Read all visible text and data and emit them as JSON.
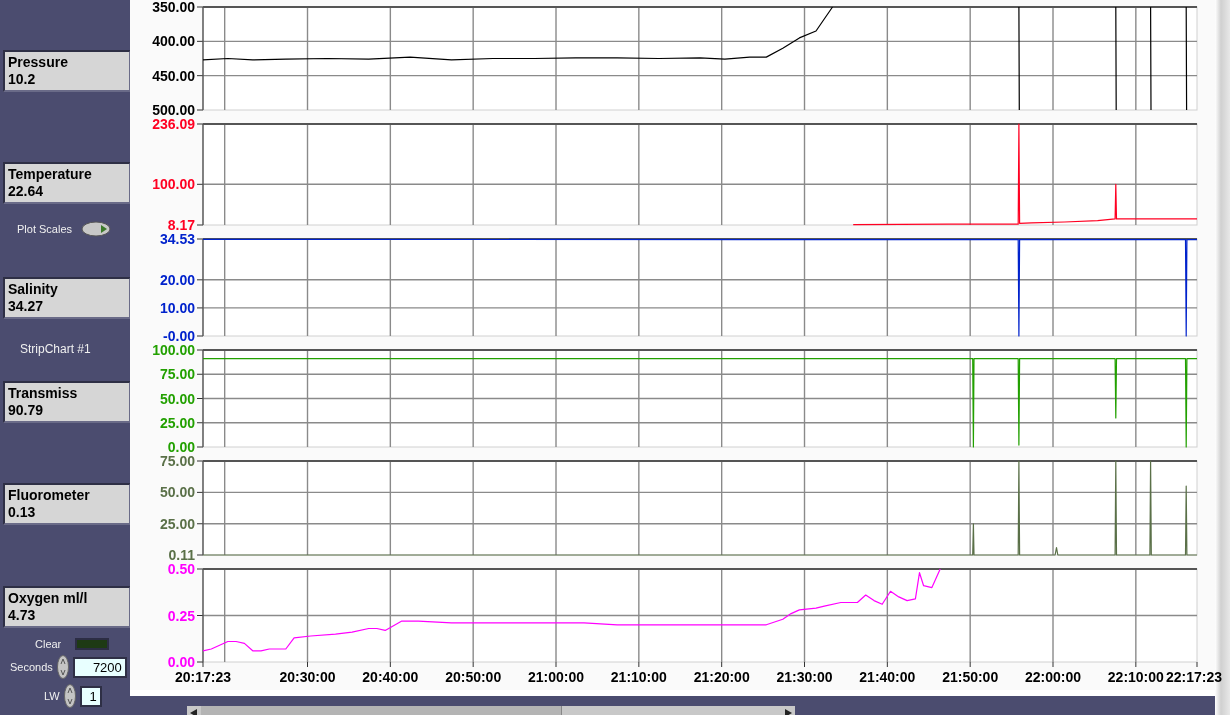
{
  "sidebar": {
    "items": [
      {
        "kind": "indicator",
        "label": "Pressure",
        "value": "10.2"
      },
      {
        "kind": "indicator",
        "label": "Temperature",
        "value": "22.64"
      },
      {
        "kind": "toggle",
        "label": "Plot Scales"
      },
      {
        "kind": "indicator",
        "label": "Salinity",
        "value": "34.27"
      },
      {
        "kind": "caption",
        "label": "StripChart #1"
      },
      {
        "kind": "indicator",
        "label": "Transmiss",
        "value": "90.79"
      },
      {
        "kind": "indicator",
        "label": "Fluorometer",
        "value": "0.13"
      },
      {
        "kind": "indicator",
        "label": "Oxygen ml/l",
        "value": "4.73"
      },
      {
        "kind": "led",
        "label": "Clear",
        "on": false
      },
      {
        "kind": "spinner",
        "label": "Seconds",
        "value": "7200"
      },
      {
        "kind": "spinner",
        "label": "LW",
        "value": "1"
      }
    ]
  },
  "charts": [
    {
      "chart_data": {
        "type": "line",
        "grid": true,
        "xlim": [
          73043,
          80243
        ],
        "ylim": [
          500,
          350
        ],
        "yticks": [
          {
            "value": 350,
            "label": "350.00"
          },
          {
            "value": 400,
            "label": "400.00"
          },
          {
            "value": 450,
            "label": "450.00"
          },
          {
            "value": 500,
            "label": "500.00"
          }
        ],
        "x": [
          73043,
          73223,
          73403,
          73643,
          73943,
          74243,
          74543,
          74843,
          75143,
          75443,
          75743,
          76043,
          76343,
          76643,
          76823,
          77003,
          77123,
          77243,
          77363,
          77483,
          77603,
          78950,
          78953,
          78956,
          79652,
          79655,
          79658,
          79904,
          79907,
          79910,
          80162,
          80165,
          80168
        ],
        "series": [
          {
            "color": "#000000",
            "values": [
              427,
              425,
              427,
              426,
              425,
              426,
              423,
              427,
              425,
              425,
              424,
              424,
              425,
              424,
              426,
              423,
              423,
              410,
              395,
              385,
              350,
              null,
              350,
              500,
              null,
              350,
              500,
              null,
              350,
              500,
              null,
              350,
              500
            ]
          }
        ]
      }
    },
    {
      "chart_data": {
        "type": "line",
        "grid": true,
        "xlim": [
          73043,
          80243
        ],
        "ylim": [
          8.17,
          236.09
        ],
        "yticks": [
          {
            "value": 236.09,
            "label": "236.09"
          },
          {
            "value": 100,
            "label": "100.00"
          },
          {
            "value": 8.17,
            "label": "8.17"
          }
        ],
        "x": [
          77753,
          78443,
          78948,
          78953,
          78958,
          79043,
          79283,
          79523,
          79650,
          79655,
          79660,
          80243
        ],
        "series": [
          {
            "color": "#ff0022",
            "values": [
              9,
              10,
              10,
              236,
              12,
              13,
              15,
              18,
              22,
              100,
              22,
              22
            ]
          }
        ]
      }
    },
    {
      "chart_data": {
        "type": "line",
        "grid": true,
        "xlim": [
          73043,
          80243
        ],
        "ylim": [
          0,
          34.53
        ],
        "yticks": [
          {
            "value": 34.53,
            "label": "34.53"
          },
          {
            "value": 20,
            "label": "20.00"
          },
          {
            "value": 10,
            "label": "10.00"
          },
          {
            "value": 0,
            "label": "-0.00"
          }
        ],
        "x": [
          73043,
          78948,
          78953,
          78958,
          80160,
          80165,
          80170,
          80243
        ],
        "series": [
          {
            "color": "#0022cc",
            "values": [
              34.4,
              34.3,
              0,
              34.3,
              34.3,
              0,
              34.3,
              34.3
            ]
          }
        ]
      }
    },
    {
      "chart_data": {
        "type": "line",
        "grid": true,
        "xlim": [
          73043,
          80243
        ],
        "ylim": [
          0,
          100
        ],
        "yticks": [
          {
            "value": 100,
            "label": "100.00"
          },
          {
            "value": 75,
            "label": "75.00"
          },
          {
            "value": 50,
            "label": "50.00"
          },
          {
            "value": 25,
            "label": "25.00"
          },
          {
            "value": 0,
            "label": "0.00"
          }
        ],
        "x": [
          73043,
          78618,
          78623,
          78628,
          78948,
          78953,
          78958,
          79650,
          79655,
          79660,
          80160,
          80165,
          80170,
          80243
        ],
        "series": [
          {
            "color": "#22a000",
            "values": [
              91,
              91,
              0,
              91,
              91,
              2,
              91,
              91,
              30,
              91,
              91,
              0,
              91,
              91
            ]
          }
        ]
      }
    },
    {
      "chart_data": {
        "type": "line",
        "grid": true,
        "xlim": [
          73043,
          80243
        ],
        "ylim": [
          0.11,
          75
        ],
        "yticks": [
          {
            "value": 75,
            "label": "75.00"
          },
          {
            "value": 50,
            "label": "50.00"
          },
          {
            "value": 25,
            "label": "25.00"
          },
          {
            "value": 0.11,
            "label": "0.11"
          }
        ],
        "x": [
          73043,
          78618,
          78623,
          78628,
          78948,
          78953,
          78958,
          79215,
          79225,
          79235,
          79650,
          79655,
          79660,
          79902,
          79907,
          79912,
          80160,
          80165,
          80170,
          80243
        ],
        "series": [
          {
            "color": "#5a7048",
            "values": [
              0.11,
              0.11,
              25,
              0.11,
              0.11,
              75,
              0.11,
              0.11,
              6,
              0.11,
              0.11,
              75,
              0.11,
              0.11,
              75,
              0.11,
              0.11,
              55,
              0.11,
              0.11
            ]
          }
        ]
      }
    },
    {
      "chart_data": {
        "type": "line",
        "grid": true,
        "xlim": [
          73043,
          80243
        ],
        "ylim": [
          0,
          0.5
        ],
        "yticks": [
          {
            "value": 0.5,
            "label": "0.50"
          },
          {
            "value": 0.25,
            "label": "0.25"
          },
          {
            "value": 0,
            "label": "0.00"
          }
        ],
        "xticks": [
          {
            "value": 73043,
            "label": "20:17:23"
          },
          {
            "value": 73800,
            "label": "20:30:00"
          },
          {
            "value": 74400,
            "label": "20:40:00"
          },
          {
            "value": 75000,
            "label": "20:50:00"
          },
          {
            "value": 75600,
            "label": "21:00:00"
          },
          {
            "value": 76200,
            "label": "21:10:00"
          },
          {
            "value": 76800,
            "label": "21:20:00"
          },
          {
            "value": 77400,
            "label": "21:30:00"
          },
          {
            "value": 78000,
            "label": "21:40:00"
          },
          {
            "value": 78600,
            "label": "21:50:00"
          },
          {
            "value": 79200,
            "label": "22:00:00"
          },
          {
            "value": 79800,
            "label": "22:10:00"
          },
          {
            "value": 80243,
            "label": "22:17:23"
          }
        ],
        "x": [
          73043,
          73103,
          73163,
          73223,
          73283,
          73343,
          73403,
          73463,
          73523,
          73643,
          73703,
          73823,
          74003,
          74123,
          74243,
          74303,
          74363,
          74483,
          74603,
          74843,
          75203,
          75443,
          75803,
          76043,
          76403,
          76643,
          77003,
          77123,
          77243,
          77303,
          77363,
          77483,
          77543,
          77663,
          77723,
          77783,
          77843,
          77903,
          77963,
          78023,
          78083,
          78143,
          78203,
          78233,
          78263,
          78323,
          78383
        ],
        "series": [
          {
            "color": "#ff00ff",
            "values": [
              0.06,
              0.07,
              0.09,
              0.11,
              0.11,
              0.1,
              0.06,
              0.06,
              0.07,
              0.07,
              0.13,
              0.14,
              0.15,
              0.16,
              0.18,
              0.18,
              0.17,
              0.22,
              0.22,
              0.21,
              0.21,
              0.21,
              0.21,
              0.2,
              0.2,
              0.2,
              0.2,
              0.2,
              0.23,
              0.26,
              0.28,
              0.29,
              0.3,
              0.32,
              0.32,
              0.32,
              0.36,
              0.33,
              0.31,
              0.38,
              0.35,
              0.33,
              0.34,
              0.48,
              0.41,
              0.4,
              0.5
            ]
          }
        ]
      }
    }
  ]
}
